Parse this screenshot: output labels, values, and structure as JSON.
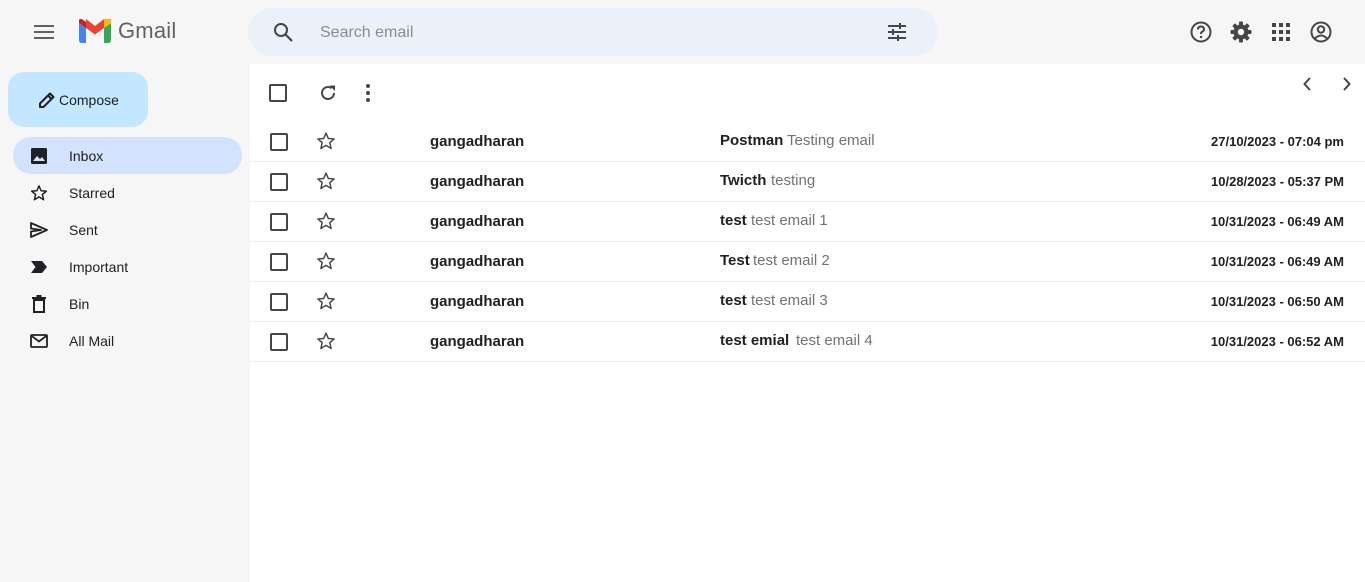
{
  "header": {
    "app_name": "Gmail",
    "search_placeholder": "Search email",
    "icons": [
      "main-menu-icon",
      "search-icon",
      "search-options-icon",
      "help-icon",
      "settings-icon",
      "apps-icon",
      "account-icon"
    ]
  },
  "sidebar": {
    "compose_label": "Compose",
    "items": [
      {
        "label": "Inbox",
        "icon": "inbox-icon",
        "active": true
      },
      {
        "label": "Starred",
        "icon": "star-icon"
      },
      {
        "label": "Sent",
        "icon": "send-icon"
      },
      {
        "label": "Important",
        "icon": "important-icon"
      },
      {
        "label": "Bin",
        "icon": "trash-icon"
      },
      {
        "label": "All Mail",
        "icon": "mail-icon"
      }
    ]
  },
  "emails": [
    {
      "sender": "gangadharan",
      "subject": "Postman",
      "snippet": "Testing email",
      "date": "27/10/2023 - 07:04 pm"
    },
    {
      "sender": "gangadharan",
      "subject": "Twicth",
      "snippet": "testing",
      "date": "10/28/2023 - 05:37 PM"
    },
    {
      "sender": "gangadharan",
      "subject": "test",
      "snippet": "test email 1",
      "date": "10/31/2023 - 06:49 AM"
    },
    {
      "sender": "gangadharan",
      "subject": "Test",
      "snippet": "test email 2",
      "date": "10/31/2023 - 06:49 AM"
    },
    {
      "sender": "gangadharan",
      "subject": "test",
      "snippet": "test email 3",
      "date": "10/31/2023 - 06:50 AM"
    },
    {
      "sender": "gangadharan",
      "subject": "test emial",
      "snippet": "test email 4",
      "date": "10/31/2023 - 06:52 AM"
    }
  ],
  "colors": {
    "background": "#f6f6f6",
    "search_bg": "#eaf1fb",
    "compose_bg": "#c2e7ff",
    "active_nav_bg": "#d3e3fd",
    "main_bg": "#ffffff"
  }
}
